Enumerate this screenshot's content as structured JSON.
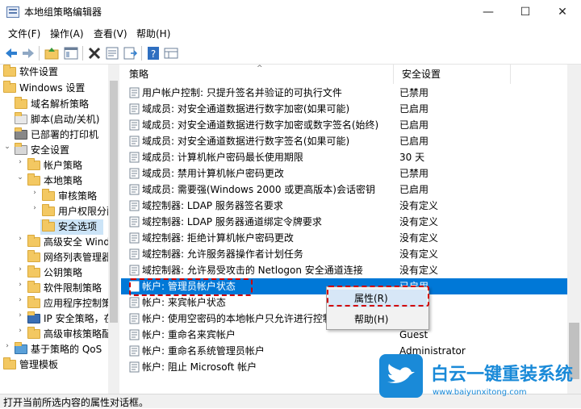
{
  "window": {
    "title": "本地组策略编辑器",
    "minimize": "—",
    "maximize": "☐",
    "close": "✕"
  },
  "menu": [
    "文件(F)",
    "操作(A)",
    "查看(V)",
    "帮助(H)"
  ],
  "toolbar": {
    "icons": [
      "back-icon",
      "forward-icon",
      "up-folder-icon",
      "show-tree-icon",
      "delete-icon",
      "properties-icon",
      "export-icon",
      "help-icon",
      "view-icon"
    ]
  },
  "tree": [
    {
      "label": "软件设置",
      "indent": 0
    },
    {
      "label": "Windows 设置",
      "indent": 0
    },
    {
      "label": "域名解析策略",
      "indent": 1
    },
    {
      "label": "脚本(启动/关机)",
      "indent": 1
    },
    {
      "label": "已部署的打印机",
      "indent": 1
    },
    {
      "label": "安全设置",
      "indent": 1
    },
    {
      "label": "帐户策略",
      "indent": 2
    },
    {
      "label": "本地策略",
      "indent": 2
    },
    {
      "label": "审核策略",
      "indent": 3
    },
    {
      "label": "用户权限分配",
      "indent": 3
    },
    {
      "label": "安全选项",
      "indent": 3
    },
    {
      "label": "高级安全 Wind",
      "indent": 2
    },
    {
      "label": "网络列表管理器",
      "indent": 2
    },
    {
      "label": "公钥策略",
      "indent": 2
    },
    {
      "label": "软件限制策略",
      "indent": 2
    },
    {
      "label": "应用程序控制策",
      "indent": 2
    },
    {
      "label": "IP 安全策略，在",
      "indent": 2
    },
    {
      "label": "高级审核策略配",
      "indent": 2
    },
    {
      "label": "基于策略的 QoS",
      "indent": 1
    },
    {
      "label": "管理模板",
      "indent": 0
    }
  ],
  "columns": {
    "policy": "策略",
    "setting": "安全设置"
  },
  "policies": [
    {
      "name": "用户帐户控制: 只提升签名并验证的可执行文件",
      "value": "已禁用"
    },
    {
      "name": "域成员: 对安全通道数据进行数字加密(如果可能)",
      "value": "已启用"
    },
    {
      "name": "域成员: 对安全通道数据进行数字加密或数字签名(始终)",
      "value": "已启用"
    },
    {
      "name": "域成员: 对安全通道数据进行数字签名(如果可能)",
      "value": "已启用"
    },
    {
      "name": "域成员: 计算机帐户密码最长使用期限",
      "value": "30 天"
    },
    {
      "name": "域成员: 禁用计算机帐户密码更改",
      "value": "已禁用"
    },
    {
      "name": "域成员: 需要强(Windows 2000 或更高版本)会话密钥",
      "value": "已启用"
    },
    {
      "name": "域控制器: LDAP 服务器签名要求",
      "value": "没有定义"
    },
    {
      "name": "域控制器: LDAP 服务器通道绑定令牌要求",
      "value": "没有定义"
    },
    {
      "name": "域控制器: 拒绝计算机帐户密码更改",
      "value": "没有定义"
    },
    {
      "name": "域控制器: 允许服务器操作者计划任务",
      "value": "没有定义"
    },
    {
      "name": "域控制器: 允许易受攻击的 Netlogon 安全通道连接",
      "value": "没有定义"
    },
    {
      "name": "帐户: 管理员帐户状态",
      "value": "已启用"
    },
    {
      "name": "帐户: 来宾帐户状态",
      "value": ""
    },
    {
      "name": "帐户: 使用空密码的本地帐户只允许进行控制台",
      "value": ""
    },
    {
      "name": "帐户: 重命名来宾帐户",
      "value": "Guest"
    },
    {
      "name": "帐户: 重命名系统管理员帐户",
      "value": "Administrator"
    },
    {
      "name": "帐户: 阻止 Microsoft 帐户",
      "value": ""
    }
  ],
  "context_menu": {
    "properties": "属性(R)",
    "help": "帮助(H)"
  },
  "status": "打开当前所选内容的属性对话框。",
  "watermark": {
    "brand": "白云一键重装系统",
    "url": "www.baiyunxitong.com"
  },
  "colors": {
    "selection": "#0078d7",
    "highlight_box": "#d20000",
    "watermark_blue": "#1a8ad8"
  }
}
